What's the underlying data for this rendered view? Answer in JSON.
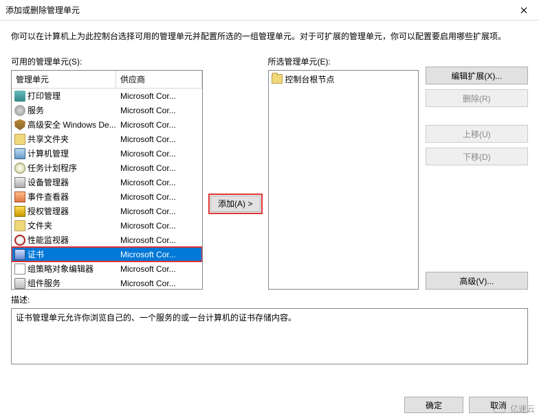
{
  "title": "添加或删除管理单元",
  "intro": "你可以在计算机上为此控制台选择可用的管理单元并配置所选的一组管理单元。对于可扩展的管理单元，你可以配置要启用哪些扩展项。",
  "available_label": "可用的管理单元(S):",
  "selected_label": "所选管理单元(E):",
  "columns": {
    "name": "管理单元",
    "vendor": "供应商"
  },
  "snapins": [
    {
      "icon": "ic-printer",
      "name": "打印管理",
      "vendor": "Microsoft Cor..."
    },
    {
      "icon": "ic-gear",
      "name": "服务",
      "vendor": "Microsoft Cor..."
    },
    {
      "icon": "ic-shield",
      "name": "高级安全 Windows De...",
      "vendor": "Microsoft Cor..."
    },
    {
      "icon": "ic-folder",
      "name": "共享文件夹",
      "vendor": "Microsoft Cor..."
    },
    {
      "icon": "ic-monitor",
      "name": "计算机管理",
      "vendor": "Microsoft Cor..."
    },
    {
      "icon": "ic-clock",
      "name": "任务计划程序",
      "vendor": "Microsoft Cor..."
    },
    {
      "icon": "ic-device",
      "name": "设备管理器",
      "vendor": "Microsoft Cor..."
    },
    {
      "icon": "ic-event",
      "name": "事件查看器",
      "vendor": "Microsoft Cor..."
    },
    {
      "icon": "ic-auth",
      "name": "授权管理器",
      "vendor": "Microsoft Cor..."
    },
    {
      "icon": "ic-folder",
      "name": "文件夹",
      "vendor": "Microsoft Cor..."
    },
    {
      "icon": "ic-no",
      "name": "性能监视器",
      "vendor": "Microsoft Cor..."
    },
    {
      "icon": "ic-cert",
      "name": "证书",
      "vendor": "Microsoft Cor...",
      "selected": true
    },
    {
      "icon": "ic-doc",
      "name": "组策略对象编辑器",
      "vendor": "Microsoft Cor..."
    },
    {
      "icon": "ic-com",
      "name": "组件服务",
      "vendor": "Microsoft Cor..."
    }
  ],
  "add_button": "添加(A) >",
  "root_node": "控制台根节点",
  "buttons": {
    "edit_ext": "编辑扩展(X)...",
    "remove": "删除(R)",
    "move_up": "上移(U)",
    "move_down": "下移(D)",
    "advanced": "高级(V)..."
  },
  "desc_label": "描述:",
  "desc_text": "证书管理单元允许你浏览自己的、一个服务的或一台计算机的证书存储内容。",
  "footer": {
    "ok": "确定",
    "cancel": "取消"
  },
  "watermark": "亿速云"
}
